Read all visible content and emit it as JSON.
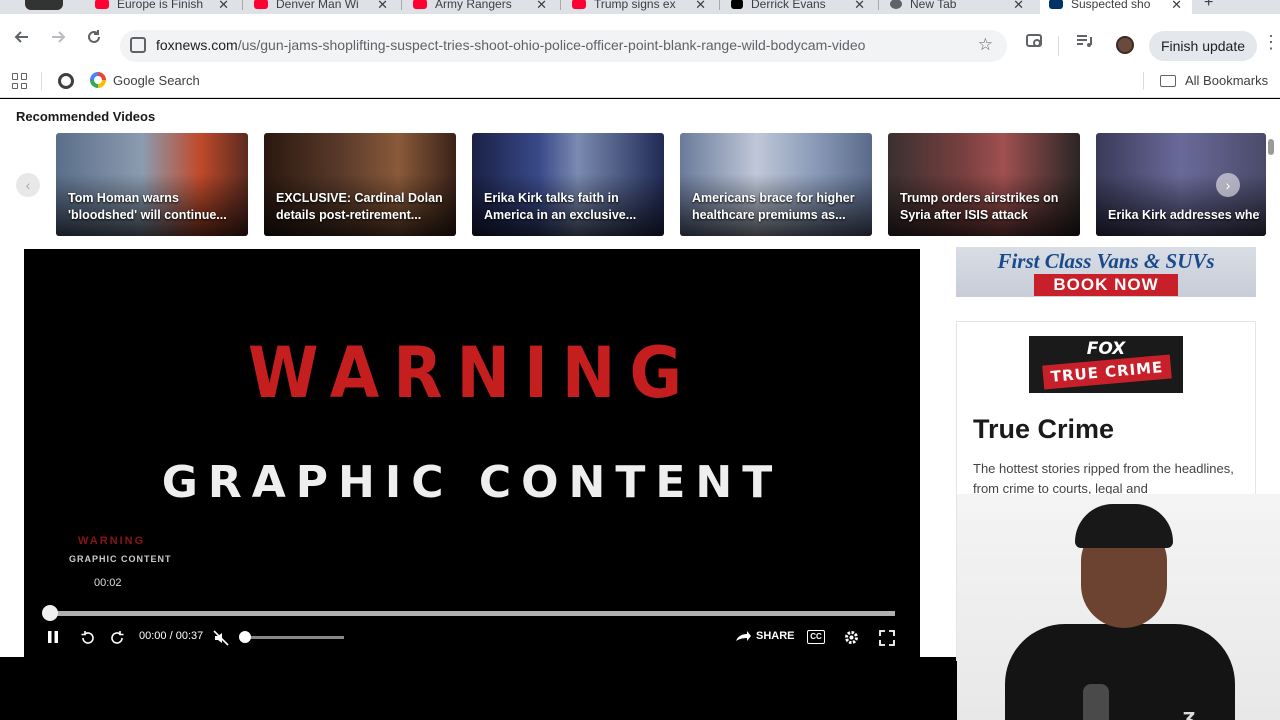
{
  "tabs": [
    {
      "title": "Europe is Finish",
      "icon": "youtube-icon"
    },
    {
      "title": "Denver Man Wi",
      "icon": "youtube-icon"
    },
    {
      "title": "Army Rangers",
      "icon": "youtube-icon"
    },
    {
      "title": "Trump signs ex",
      "icon": "youtube-icon"
    },
    {
      "title": "Derrick Evans",
      "icon": "x-icon"
    },
    {
      "title": "New Tab",
      "icon": "chrome-icon"
    },
    {
      "title": "Suspected sho",
      "icon": "foxnews-icon"
    }
  ],
  "toolbar": {
    "url_domain": "foxnews.com",
    "url_path": "/us/gun-jams-shoplifting-suspect-tries-shoot-ohio-police-officer-point-blank-range-wild-bodycam-video",
    "finish_update": "Finish update"
  },
  "bookmarks": {
    "google_search": "Google Search",
    "all_bookmarks": "All Bookmarks"
  },
  "recommended": {
    "title": "Recommended Videos",
    "items": [
      {
        "caption": "Tom Homan warns 'bloodshed' will continue..."
      },
      {
        "caption": "EXCLUSIVE: Cardinal Dolan details post-retirement..."
      },
      {
        "caption": "Erika Kirk talks faith in America in an exclusive..."
      },
      {
        "caption": "Americans brace for higher healthcare premiums as..."
      },
      {
        "caption": "Trump orders airstrikes on Syria after ISIS attack"
      },
      {
        "caption": "Erika Kirk addresses whether she has 'commo..."
      }
    ]
  },
  "player": {
    "warning": "WARNING",
    "graphic_content": "GRAPHIC CONTENT",
    "preview_warning": "WARNING",
    "preview_graphic": "GRAPHIC CONTENT",
    "preview_time": "00:02",
    "current_time": "00:00",
    "separator": "/",
    "duration": "00:37",
    "share_label": "SHARE",
    "cc_label": "CC",
    "progress": 0,
    "volume": 0
  },
  "ad": {
    "headline": "First Class Vans & SUVs",
    "button": "BOOK NOW"
  },
  "true_crime": {
    "logo_brand": "FOX",
    "logo_label": "TRUE CRIME",
    "title": "True Crime",
    "description": "The hottest stories ripped from the headlines, from crime to courts, legal and"
  },
  "colors": {
    "warning_red": "#c41e1e",
    "fox_red": "#c8202a",
    "youtube_red": "#ff0033"
  }
}
